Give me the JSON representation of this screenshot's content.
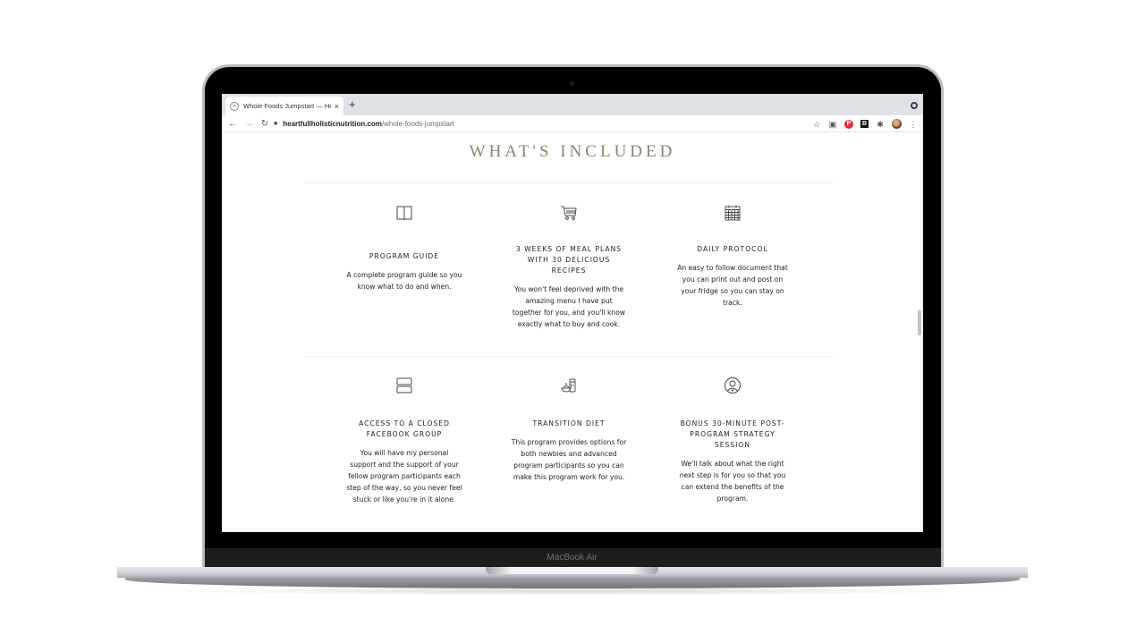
{
  "device": {
    "label": "MacBook Air"
  },
  "browser": {
    "tab": {
      "title": "Whole Foods Jumpstart — Hea",
      "favicon": "site-favicon",
      "close_icon": "×"
    },
    "new_tab_icon": "+",
    "nav": {
      "back_icon": "←",
      "forward_icon": "→",
      "reload_icon": "↻"
    },
    "url": {
      "lock_icon": "🔒",
      "host": "heartfullholisticnutrition.com",
      "path": "/whole-foods-jumpstart"
    },
    "toolbar_icons": {
      "star": "☆",
      "camera": "📷",
      "pinterest": "P",
      "b_extension": "B",
      "extensions": "✱",
      "menu": "⋮"
    }
  },
  "page": {
    "section_title": "WHAT'S INCLUDED",
    "features": [
      {
        "icon": "book-icon",
        "title": "PROGRAM GUIDE",
        "description": "A complete program guide so you know what to do and when."
      },
      {
        "icon": "shopping-cart-icon",
        "title": "3 WEEKS OF MEAL PLANS WITH 30 DELICIOUS RECIPES",
        "description": "You won't feel deprived with the amazing menu I have put together for you, and you'll know exactly what to buy and cook."
      },
      {
        "icon": "calendar-icon",
        "title": "DAILY PROTOCOL",
        "description": "An easy to follow document that you can print out and post on your fridge so you can stay on track."
      },
      {
        "icon": "group-icon",
        "title": "ACCESS TO A CLOSED FACEBOOK GROUP",
        "description": "You will have my personal support and the support of your fellow program participants each step of the way, so you never feel stuck or like you're in it alone."
      },
      {
        "icon": "food-jar-icon",
        "title": "TRANSITION DIET",
        "description": "This program provides options for both newbies and advanced program participants so you can make this program work for you."
      },
      {
        "icon": "user-circle-icon",
        "title": "BONUS 30-MINUTE POST-PROGRAM STRATEGY SESSION",
        "description": "We'll talk about what the right next step is for you so that you can extend the benefits of the program."
      }
    ]
  },
  "colors": {
    "title_accent": "#8b8470",
    "tabbar_bg": "#dee1e6",
    "text": "#222222"
  }
}
